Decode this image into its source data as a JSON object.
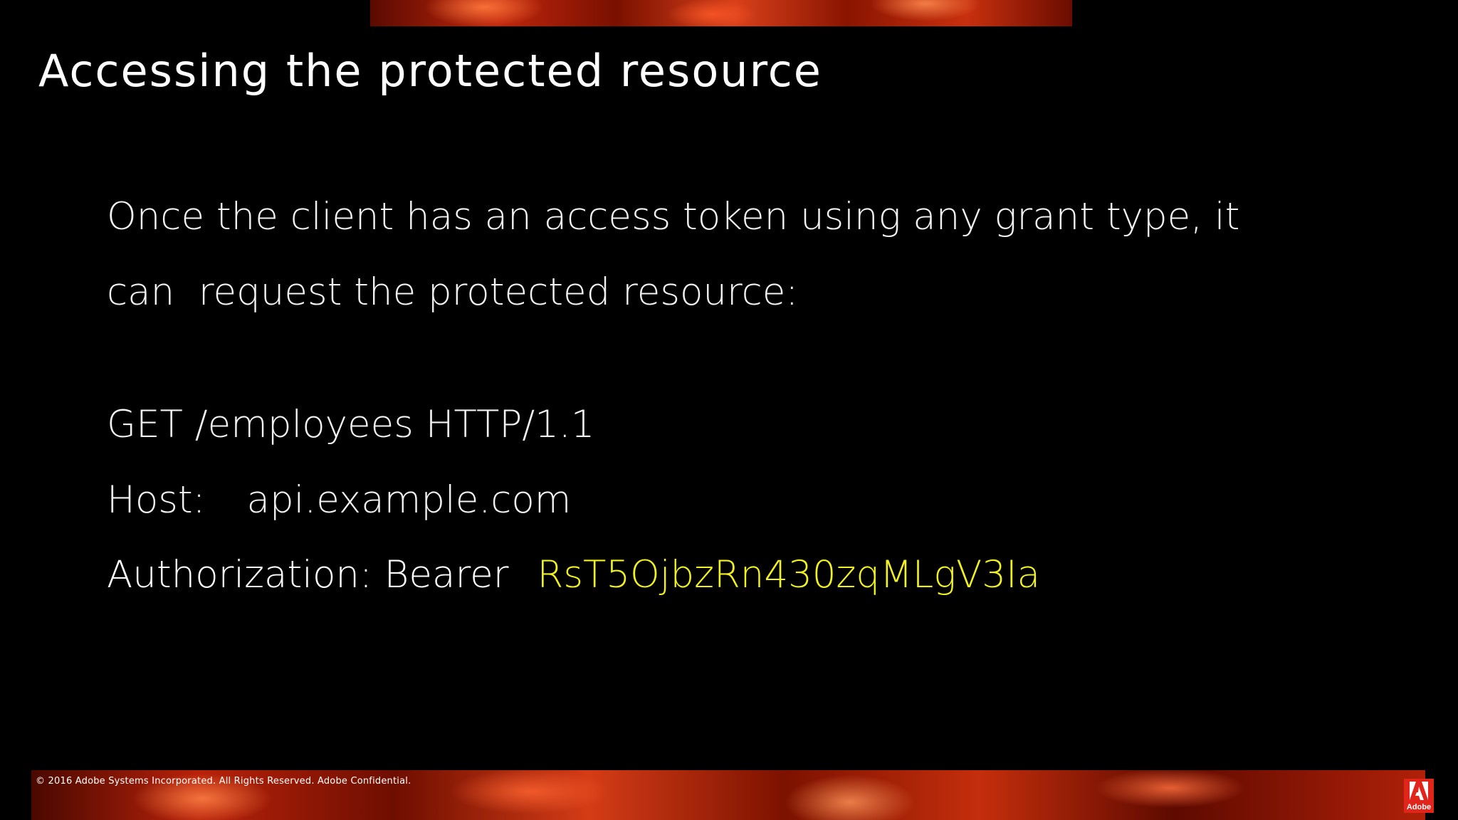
{
  "slide": {
    "title": "Accessing the protected resource",
    "body_line1": "Once the client has an access token using any grant type, it",
    "body_line2": "can  request the protected resource:",
    "request_line": "GET /employees HTTP/1.1",
    "host_label": "Host:",
    "host_value": "api.example.com",
    "auth_label": "Authorization: Bearer",
    "token": "RsT5OjbzRn430zqMLgV3Ia"
  },
  "footer": {
    "copyright": "© 2016 Adobe Systems Incorporated.  All Rights Reserved.  Adobe Confidential.",
    "logo_text": "Adobe"
  },
  "colors": {
    "background": "#000000",
    "text": "#ffffff",
    "token": "#f2f21e",
    "brand": "#e1251b"
  }
}
